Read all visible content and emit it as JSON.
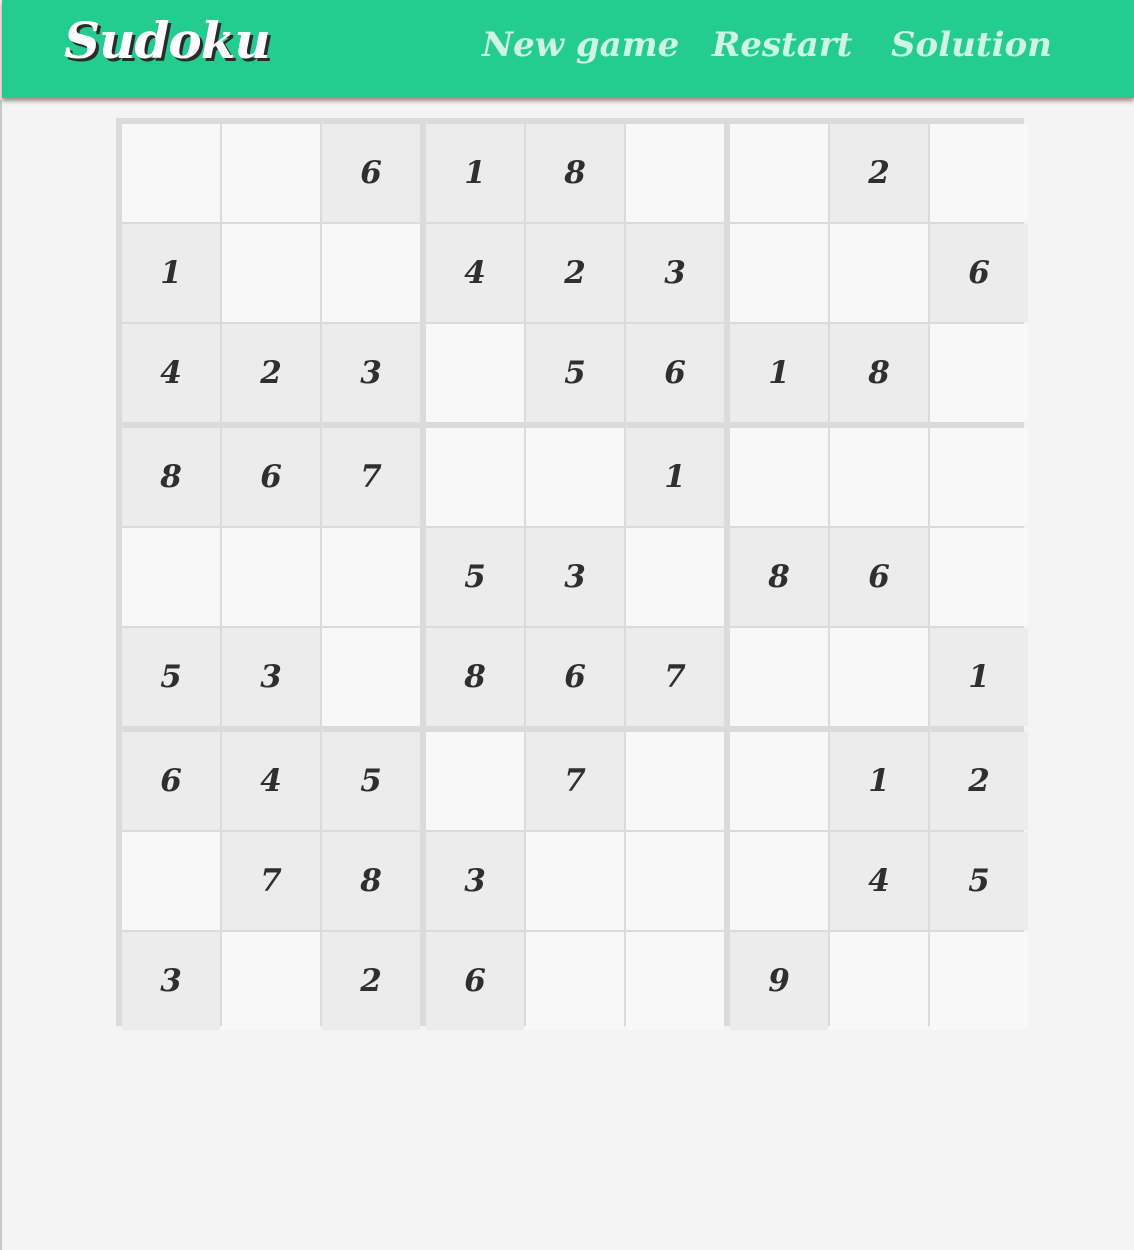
{
  "header": {
    "logo": "Sudoku",
    "nav": {
      "new_game": "New game",
      "restart": "Restart",
      "solution": "Solution"
    },
    "accent_color": "#24cc8f"
  },
  "board": {
    "grid": [
      [
        "",
        "",
        "6",
        "1",
        "8",
        "",
        "",
        "2",
        ""
      ],
      [
        "1",
        "",
        "",
        "4",
        "2",
        "3",
        "",
        "",
        "6"
      ],
      [
        "4",
        "2",
        "3",
        "",
        "5",
        "6",
        "1",
        "8",
        ""
      ],
      [
        "8",
        "6",
        "7",
        "",
        "",
        "1",
        "",
        "",
        ""
      ],
      [
        "",
        "",
        "",
        "5",
        "3",
        "",
        "8",
        "6",
        ""
      ],
      [
        "5",
        "3",
        "",
        "8",
        "6",
        "7",
        "",
        "",
        "1"
      ],
      [
        "6",
        "4",
        "5",
        "",
        "7",
        "",
        "",
        "1",
        "2"
      ],
      [
        "",
        "7",
        "8",
        "3",
        "",
        "",
        "",
        "4",
        "5"
      ],
      [
        "3",
        "",
        "2",
        "6",
        "",
        "",
        "9",
        "",
        ""
      ]
    ]
  }
}
